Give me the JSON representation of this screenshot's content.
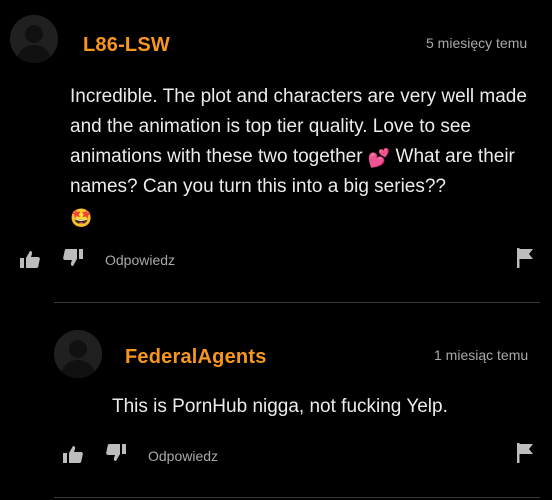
{
  "colors": {
    "background": "#000000",
    "username": "#f7971d",
    "muted": "#a9a9a9",
    "text": "#ececec",
    "avatar": "#222222"
  },
  "comments": [
    {
      "username": "L86-LSW",
      "timestamp": "5 miesięcy temu",
      "text_segments": [
        "Incredible. The plot and characters are very well made and the animation is top tier quality. Love to see animations with these two together ",
        " What are their names? Can you turn this into a big series?? "
      ],
      "emojis": [
        "💕",
        "🤩"
      ],
      "reply_label": "Odpowiedz",
      "icons": [
        "thumbs-up-icon",
        "thumbs-down-icon",
        "flag-icon"
      ]
    },
    {
      "username": "FederalAgents",
      "timestamp": "1 miesiąc temu",
      "text": "This is PornHub nigga, not fucking Yelp.",
      "reply_label": "Odpowiedz",
      "icons": [
        "thumbs-up-icon",
        "thumbs-down-icon",
        "flag-icon"
      ]
    }
  ]
}
